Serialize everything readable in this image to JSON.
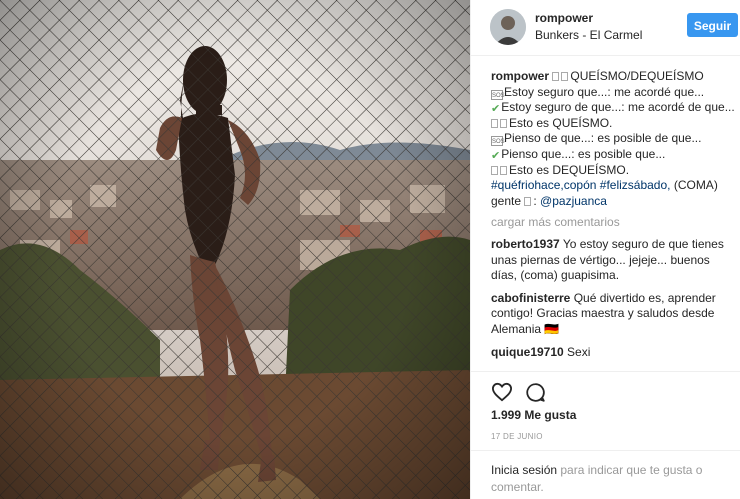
{
  "header": {
    "username": "rompower",
    "location": "Bunkers - El Carmel",
    "follow_label": "Seguir"
  },
  "caption": {
    "username": "rompower",
    "lines": [
      "QUEÍSMO/DEQUEÍSMO",
      "Estoy seguro que...: me acordé que...",
      "Estoy seguro de que...: me acordé de que...",
      "Esto es QUEÍSMO.",
      "Pienso de que...: es posible de que...",
      "Pienso que...: es posible que...",
      "Esto es DEQUEÍSMO."
    ],
    "hashtag1": "#quéfriohace,copón",
    "hashtag2": "#felizsábado,",
    "coma_text": " (COMA)",
    "gente_text": "gente",
    "mention": "@pazjuanca"
  },
  "load_more": "cargar más comentarios",
  "comments": [
    {
      "user": "roberto1937",
      "text": "Yo estoy seguro de que tienes unas piernas de vértigo... jejeje... buenos días, (coma) guapisima."
    },
    {
      "user": "cabofinisterre",
      "text": "Qué divertido es, aprender contigo! Gracias maestra y saludos desde Alemania 🇩🇪"
    },
    {
      "user": "quique19710",
      "text": "Sexi"
    }
  ],
  "likes": "1.999 Me gusta",
  "date": "17 DE JUNIO",
  "login": {
    "link": "Inicia sesión",
    "text": " para indicar que te gusta o comentar."
  },
  "icons": {
    "like": "heart-icon",
    "comment": "comment-icon",
    "sos": "sos-icon",
    "check": "check-icon"
  },
  "colors": {
    "follow_button": "#3897f0",
    "link": "#003569",
    "muted": "#999999"
  }
}
